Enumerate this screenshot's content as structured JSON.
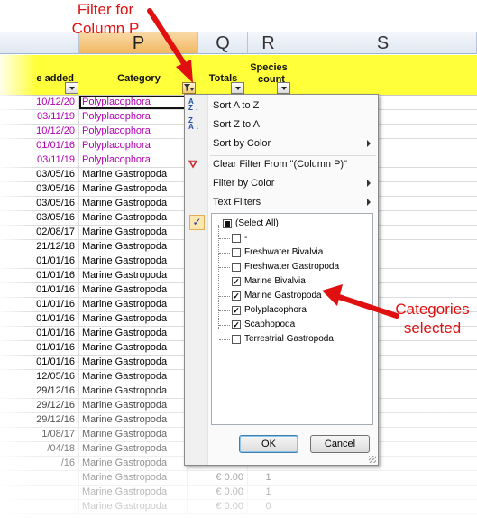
{
  "columns": [
    {
      "letter": "",
      "left": 0
    },
    {
      "letter": "P",
      "selected": true
    },
    {
      "letter": "Q"
    },
    {
      "letter": "R"
    },
    {
      "letter": "S"
    }
  ],
  "headers": {
    "date": "e added",
    "category": "Category",
    "totals": "Totals",
    "species_line1": "Species",
    "species_line2": "count"
  },
  "rows": [
    {
      "date": "10/12/20",
      "category": "Polyplacophora",
      "purple": true,
      "active": true
    },
    {
      "date": "03/11/19",
      "category": "Polyplacophora",
      "purple": true
    },
    {
      "date": "10/12/20",
      "category": "Polyplacophora",
      "purple": true
    },
    {
      "date": "01/01/16",
      "category": "Polyplacophora",
      "purple": true
    },
    {
      "date": "03/11/19",
      "category": "Polyplacophora",
      "purple": true
    },
    {
      "date": "03/05/16",
      "category": "Marine Gastropoda"
    },
    {
      "date": "03/05/16",
      "category": "Marine Gastropoda"
    },
    {
      "date": "03/05/16",
      "category": "Marine Gastropoda"
    },
    {
      "date": "03/05/16",
      "category": "Marine Gastropoda"
    },
    {
      "date": "02/08/17",
      "category": "Marine Gastropoda"
    },
    {
      "date": "21/12/18",
      "category": "Marine Gastropoda"
    },
    {
      "date": "01/01/16",
      "category": "Marine Gastropoda"
    },
    {
      "date": "01/01/16",
      "category": "Marine Gastropoda"
    },
    {
      "date": "01/01/16",
      "category": "Marine Gastropoda"
    },
    {
      "date": "01/01/16",
      "category": "Marine Gastropoda"
    },
    {
      "date": "01/01/16",
      "category": "Marine Gastropoda"
    },
    {
      "date": "01/01/16",
      "category": "Marine Gastropoda"
    },
    {
      "date": "01/01/16",
      "category": "Marine Gastropoda"
    },
    {
      "date": "01/01/16",
      "category": "Marine Gastropoda"
    },
    {
      "date": "12/05/16",
      "category": "Marine Gastropoda"
    },
    {
      "date": "29/12/16",
      "category": "Marine Gastropoda"
    },
    {
      "date": "29/12/16",
      "category": "Marine Gastropoda"
    },
    {
      "date": "29/12/16",
      "category": "Marine Gastropoda"
    },
    {
      "date": "1/08/17",
      "category": "Marine Gastropoda"
    },
    {
      "date": "/04/18",
      "category": "Marine Gastropoda"
    },
    {
      "date": "/16",
      "category": "Marine Gastropoda"
    },
    {
      "date": "",
      "category": "Marine Gastropoda",
      "totals": "€ 0.00",
      "count": "1"
    },
    {
      "date": "",
      "category": "Marine Gastropoda",
      "totals": "€ 0.00",
      "count": "1"
    },
    {
      "date": "",
      "category": "Marine Gastropoda",
      "totals": "€ 0.00",
      "count": "0"
    }
  ],
  "menu": {
    "sort_az": "Sort A to Z",
    "sort_za": "Sort Z to A",
    "sort_color": "Sort by Color",
    "clear_filter": "Clear Filter From \"(Column P)\"",
    "filter_color": "Filter by Color",
    "text_filters": "Text Filters",
    "items": [
      {
        "label": "(Select All)",
        "state": "partial",
        "indent": 0
      },
      {
        "label": "-",
        "state": "off",
        "indent": 1
      },
      {
        "label": "Freshwater Bivalvia",
        "state": "off",
        "indent": 1
      },
      {
        "label": "Freshwater Gastropoda",
        "state": "off",
        "indent": 1
      },
      {
        "label": "Marine Bivalvia",
        "state": "on",
        "indent": 1
      },
      {
        "label": "Marine Gastropoda",
        "state": "on",
        "indent": 1
      },
      {
        "label": "Polyplacophora",
        "state": "on",
        "indent": 1
      },
      {
        "label": "Scaphopoda",
        "state": "on",
        "indent": 1
      },
      {
        "label": "Terrestrial Gastropoda",
        "state": "off",
        "indent": 1
      }
    ],
    "ok": "OK",
    "cancel": "Cancel"
  },
  "annotations": {
    "filter_label_1": "Filter for",
    "filter_label_2": "Column P",
    "selected_label_1": "Categories",
    "selected_label_2": "selected",
    "color": "#e01010"
  }
}
